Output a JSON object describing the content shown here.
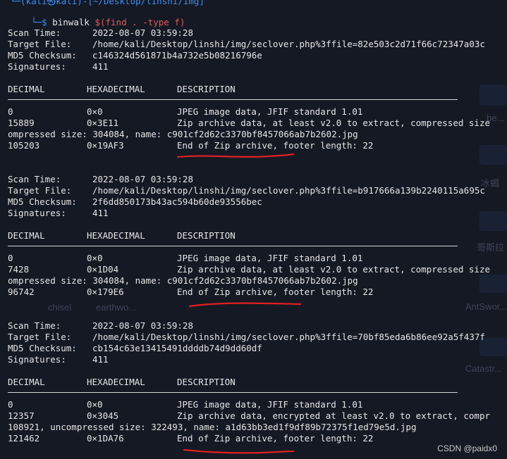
{
  "prompt": {
    "top_fragment": "└─(kali㉿kali)-[~/Desktop/linshi/img]",
    "arrow": "└─$",
    "command_binwalk": "binwalk",
    "command_sub": "$(find . -type f)"
  },
  "labels": {
    "scan_time": "Scan Time:",
    "target_file": "Target File:",
    "md5": "MD5 Checksum:",
    "signatures": "Signatures:"
  },
  "headers": [
    "DECIMAL",
    "HEXADECIMAL",
    "DESCRIPTION"
  ],
  "scans": [
    {
      "scan_time": "2022-08-07 03:59:28",
      "target_file": "/home/kali/Desktop/linshi/img/seclover.php%3ffile=82e503c2d71f66c72347a03c",
      "md5": "c146324d561871b4a732e5b08216796e",
      "signatures": "411",
      "rows": [
        {
          "dec": "0",
          "hex": "0×0",
          "desc": "JPEG image data, JFIF standard 1.01"
        },
        {
          "dec": "15889",
          "hex": "0×3E11",
          "desc": "Zip archive data, at least v2.0 to extract, compressed size"
        },
        {
          "full": "ompressed size: 304084, name: c901cf2d62c3370bf8457066ab7b2602.jpg"
        },
        {
          "dec": "105203",
          "hex": "0×19AF3",
          "desc": "End of Zip archive, footer length: 22"
        }
      ]
    },
    {
      "scan_time": "2022-08-07 03:59:28",
      "target_file": "/home/kali/Desktop/linshi/img/seclover.php%3ffile=b917666a139b2240115a695c",
      "md5": "2f6dd850173b43ac594b60de93556bec",
      "signatures": "411",
      "rows": [
        {
          "dec": "0",
          "hex": "0×0",
          "desc": "JPEG image data, JFIF standard 1.01"
        },
        {
          "dec": "7428",
          "hex": "0×1D04",
          "desc": "Zip archive data, at least v2.0 to extract, compressed size"
        },
        {
          "full": "ompressed size: 304084, name: c901cf2d62c3370bf8457066ab7b2602.jpg"
        },
        {
          "dec": "96742",
          "hex": "0×179E6",
          "desc": "End of Zip archive, footer length: 22"
        }
      ]
    },
    {
      "scan_time": "2022-08-07 03:59:28",
      "target_file": "/home/kali/Desktop/linshi/img/seclover.php%3ffile=70bf85eda6b86ee92a5f437f",
      "md5": "cb154c63e13415491ddddb74d9dd60df",
      "signatures": "411",
      "rows": [
        {
          "dec": "0",
          "hex": "0×0",
          "desc": "JPEG image data, JFIF standard 1.01"
        },
        {
          "dec": "12357",
          "hex": "0×3045",
          "desc": "Zip archive data, encrypted at least v2.0 to extract, compr"
        },
        {
          "full": "108921, uncompressed size: 322493, name: a1d63bb3ed1f9df89b72375f1ed79e5d.jpg"
        },
        {
          "dec": "121462",
          "hex": "0×1DA76",
          "desc": "End of Zip archive, footer length: 22"
        }
      ]
    }
  ],
  "background_labels": [
    "chisel",
    "earthwo...",
    "AntSwor...",
    "Catastr...",
    "冰蝎",
    "哥斯拉",
    "be..."
  ],
  "watermark": "CSDN @paidx0",
  "colors": {
    "prompt": "#3d8df5",
    "command_sub": "#e05b5b",
    "underline": "#e02020",
    "background": "#151924"
  }
}
